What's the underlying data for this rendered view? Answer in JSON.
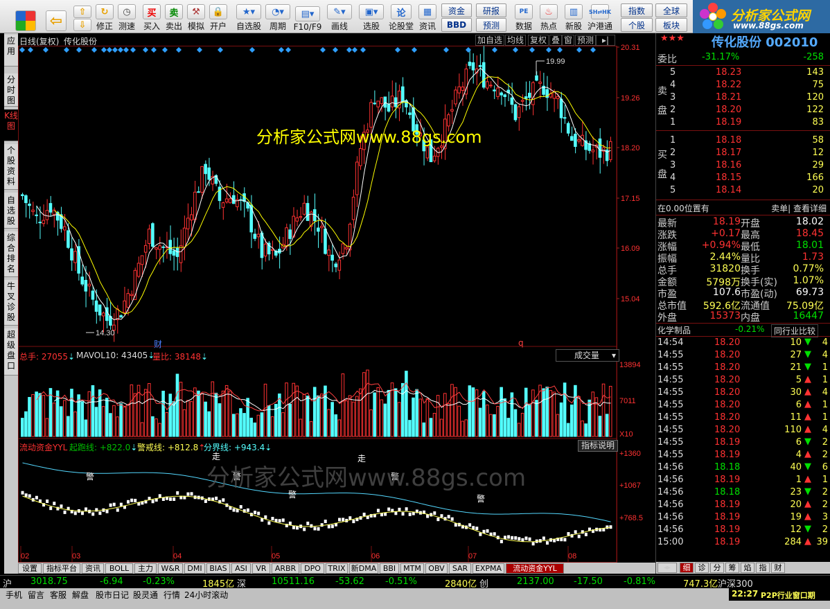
{
  "toolbar": {
    "items": [
      "修正",
      "测速",
      "买入",
      "卖出",
      "模拟",
      "开户",
      "自选股",
      "周期",
      "F10/F9",
      "画线",
      "选股",
      "论股堂",
      "资讯",
      "数据",
      "热点",
      "新股",
      "沪港通"
    ],
    "small_buttons": [
      "资金",
      "研报",
      "BBD",
      "预测",
      "指数",
      "全球",
      "个股",
      "板块"
    ]
  },
  "logo": {
    "title": "分析家公式网",
    "url": "www.88gs.com"
  },
  "left_tabs": [
    "应用",
    "分时图",
    "K线图",
    "个股资料",
    "自选股",
    "综合排名",
    "牛叉诊股",
    "超级盘口"
  ],
  "chart": {
    "header_left": "日线(复权)",
    "stock_name": "传化股份",
    "buttons": [
      "加自选",
      "均线",
      "复权",
      "叠",
      "窗",
      "预测"
    ],
    "watermark_main": "分析家公式网www.88gs.com",
    "watermark_ind": "分析家公式网www.88gs.com",
    "marker_cai": "财",
    "marker_q": "q",
    "y_ticks": [
      "20.31",
      "19.26",
      "18.20",
      "17.15",
      "16.09",
      "15.04"
    ],
    "high_label": "19.99",
    "low_label": "14.30",
    "colors": {
      "up": "#ff3232",
      "down": "#54ffff",
      "diamond": "#2f9fff",
      "ma5": "#ffffff",
      "ma10": "#ffff00",
      "ma_vol": "#ff4040"
    }
  },
  "volume": {
    "label_total": "总手: 27055",
    "label_mavol": "MAVOL10: 43405",
    "label_ratio": "量比: 38148",
    "select_value": "成交量",
    "y_ticks": [
      "13894",
      "7011",
      "X10"
    ]
  },
  "indicator": {
    "name": "流动资金YYL",
    "start_line": "起跑线: +822.0",
    "warn_line": "警戒线: +812.8",
    "divide_line": "分界线: +943.4",
    "help_button": "指标说明",
    "y_ticks": [
      "+1360",
      "+1067",
      "+768.5"
    ],
    "signals": [
      "警",
      "走",
      "警",
      "警",
      "走",
      "警",
      "警"
    ]
  },
  "x_axis": [
    "02",
    "03",
    "04",
    "05",
    "06",
    "07",
    "08"
  ],
  "bottom_tabs": [
    "设置",
    "指标平台",
    "资讯",
    "BOLL",
    "主力",
    "W&R",
    "DMI",
    "BIAS",
    "ASI",
    "VR",
    "ARBR",
    "DPO",
    "TRIX",
    "新DMA",
    "BBI",
    "MTM",
    "OBV",
    "SAR",
    "EXPMA",
    "流动资金YYL"
  ],
  "right": {
    "title": "传化股份 002010",
    "weibi_label": "委比",
    "weibi_value": "-31.17%",
    "weibi_diff": "-258",
    "sell_label": "卖盘",
    "buy_label": "买盘",
    "sell_orders": [
      {
        "level": "5",
        "price": "18.23",
        "vol": "143"
      },
      {
        "level": "4",
        "price": "18.22",
        "vol": "75"
      },
      {
        "level": "3",
        "price": "18.21",
        "vol": "120"
      },
      {
        "level": "2",
        "price": "18.20",
        "vol": "122"
      },
      {
        "level": "1",
        "price": "18.19",
        "vol": "83"
      }
    ],
    "buy_orders": [
      {
        "level": "1",
        "price": "18.18",
        "vol": "58"
      },
      {
        "level": "2",
        "price": "18.17",
        "vol": "12"
      },
      {
        "level": "3",
        "price": "18.16",
        "vol": "29"
      },
      {
        "level": "4",
        "price": "18.15",
        "vol": "166"
      },
      {
        "level": "5",
        "price": "18.14",
        "vol": "20"
      }
    ],
    "position_text": "在0.00位置有",
    "detail_link": "卖单| 查看详细",
    "quotes": [
      {
        "l1": "最新",
        "v1": "18.19",
        "l2": "开盘",
        "v2": "18.02",
        "c1": "#ff3232",
        "c2": "#ffffff"
      },
      {
        "l1": "涨跌",
        "v1": "+0.17",
        "l2": "最高",
        "v2": "18.45",
        "c1": "#ff3232",
        "c2": "#ff3232"
      },
      {
        "l1": "涨幅",
        "v1": "+0.94%",
        "l2": "最低",
        "v2": "18.01",
        "c1": "#ff3232",
        "c2": "#00e000"
      },
      {
        "l1": "振幅",
        "v1": "2.44%",
        "l2": "量比",
        "v2": "1.73",
        "c1": "#ffff54",
        "c2": "#ff3232"
      },
      {
        "l1": "总手",
        "v1": "31820",
        "l2": "换手",
        "v2": "0.77%",
        "c1": "#ffff54",
        "c2": "#ffff54"
      },
      {
        "l1": "金额",
        "v1": "5798万",
        "l2": "换手(实)",
        "v2": "1.07%",
        "c1": "#ffff54",
        "c2": "#ffff54"
      },
      {
        "l1": "市盈",
        "v1": "107.6",
        "l2": "市盈(动)",
        "v2": "69.73",
        "c1": "#ffffff",
        "c2": "#ffffff"
      },
      {
        "l1": "总市值",
        "v1": "592.6亿",
        "l2": "流通值",
        "v2": "75.09亿",
        "c1": "#ffff54",
        "c2": "#ffff54"
      },
      {
        "l1": "外盘",
        "v1": "15373",
        "l2": "内盘",
        "v2": "16447",
        "c1": "#ff3232",
        "c2": "#00e000"
      }
    ],
    "industry": "化学制品",
    "industry_change": "-0.21%",
    "industry_compare": "同行业比较",
    "ticks": [
      {
        "time": "14:54",
        "price": "18.20",
        "vol": "10",
        "dir": "down",
        "n": "4"
      },
      {
        "time": "14:55",
        "price": "18.20",
        "vol": "27",
        "dir": "down",
        "n": "4"
      },
      {
        "time": "14:55",
        "price": "18.20",
        "vol": "21",
        "dir": "down",
        "n": "1"
      },
      {
        "time": "14:55",
        "price": "18.20",
        "vol": "5",
        "dir": "up",
        "n": "1"
      },
      {
        "time": "14:55",
        "price": "18.20",
        "vol": "30",
        "dir": "up",
        "n": "4"
      },
      {
        "time": "14:55",
        "price": "18.20",
        "vol": "6",
        "dir": "up",
        "n": "1"
      },
      {
        "time": "14:55",
        "price": "18.20",
        "vol": "11",
        "dir": "up",
        "n": "1"
      },
      {
        "time": "14:55",
        "price": "18.20",
        "vol": "110",
        "dir": "up",
        "n": "4"
      },
      {
        "time": "14:55",
        "price": "18.19",
        "vol": "6",
        "dir": "down",
        "n": "2"
      },
      {
        "time": "14:55",
        "price": "18.19",
        "vol": "4",
        "dir": "up",
        "n": "2"
      },
      {
        "time": "14:56",
        "price": "18.18",
        "vol": "40",
        "dir": "down",
        "n": "6"
      },
      {
        "time": "14:56",
        "price": "18.19",
        "vol": "1",
        "dir": "up",
        "n": "1"
      },
      {
        "time": "14:56",
        "price": "18.18",
        "vol": "23",
        "dir": "down",
        "n": "2"
      },
      {
        "time": "14:56",
        "price": "18.19",
        "vol": "20",
        "dir": "up",
        "n": "2"
      },
      {
        "time": "14:56",
        "price": "18.19",
        "vol": "19",
        "dir": "up",
        "n": "3"
      },
      {
        "time": "14:56",
        "price": "18.19",
        "vol": "12",
        "dir": "down",
        "n": "2"
      },
      {
        "time": "15:00",
        "price": "18.19",
        "vol": "284",
        "dir": "up",
        "n": "39"
      }
    ],
    "bottom_tabs": [
      "细",
      "诊",
      "分",
      "筹",
      "焰",
      "指",
      "财"
    ]
  },
  "status": {
    "sh_label": "沪",
    "sh_index": "3018.75",
    "sh_change": "-6.94",
    "sh_pct": "-0.23%",
    "sh_amount": "1845亿",
    "sz_label": "深",
    "sz_index": "10511.16",
    "sz_change": "-53.62",
    "sz_pct": "-0.51%",
    "sz_amount": "2840亿",
    "cy_label": "创",
    "cy_index": "2137.00",
    "cy_change": "-17.50",
    "cy_pct": "-0.81%",
    "hs_amount": "747.3亿",
    "hs_label": "沪深300"
  },
  "taskbar": {
    "items": [
      "手机",
      "留言",
      "客服",
      "解盘",
      "股市日记",
      "股灵通",
      "行情",
      "24小时滚动"
    ],
    "clock": "22:27",
    "news": "P2P行业窗口期"
  }
}
